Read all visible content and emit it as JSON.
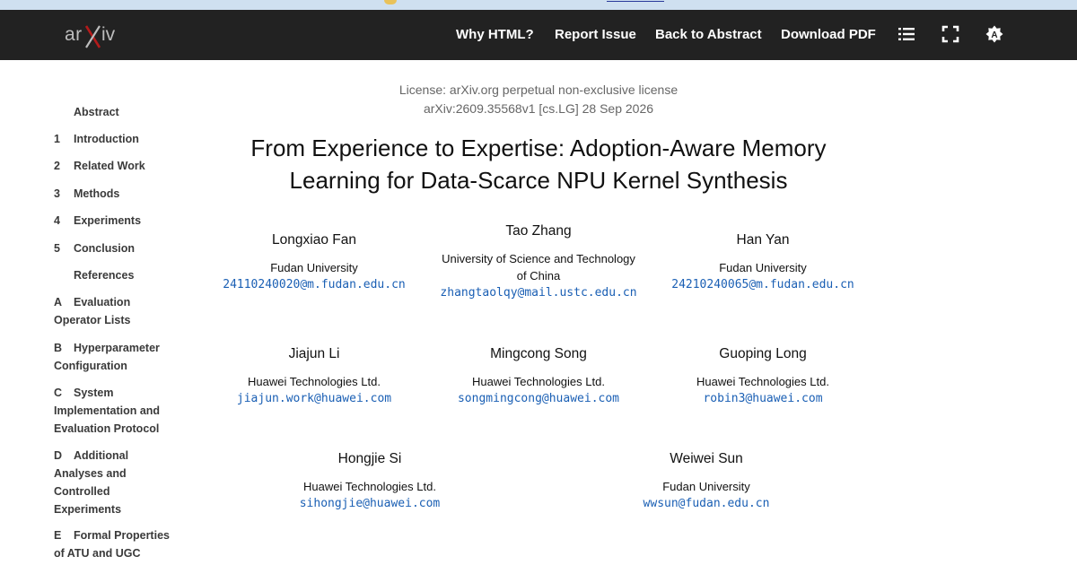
{
  "window": {
    "tab_strip_link": ""
  },
  "header": {
    "logo_text": "arXiv",
    "nav": {
      "why_html": "Why HTML?",
      "report_issue": "Report Issue",
      "back_to_abstract": "Back to Abstract",
      "download_pdf": "Download PDF"
    },
    "icons": [
      "list-icon",
      "fullscreen-icon",
      "theme-toggle-icon"
    ]
  },
  "toc": {
    "items": [
      {
        "num": "",
        "label": "Abstract"
      },
      {
        "num": "1",
        "label": "Introduction"
      },
      {
        "num": "2",
        "label": "Related Work"
      },
      {
        "num": "3",
        "label": "Methods"
      },
      {
        "num": "4",
        "label": "Experiments"
      },
      {
        "num": "5",
        "label": "Conclusion"
      },
      {
        "num": "",
        "label": "References"
      },
      {
        "num": "A",
        "label": "Evaluation",
        "label2": "Operator Lists"
      },
      {
        "num": "B",
        "label": "Hyperparameter",
        "label2": "Configuration"
      },
      {
        "num": "C",
        "label": "System",
        "label2": "Implementation and",
        "label3": "Evaluation Protocol"
      },
      {
        "num": "D",
        "label": "Additional",
        "label2": "Analyses and",
        "label3": "Controlled",
        "label4": "Experiments"
      },
      {
        "num": "E",
        "label": "Formal Properties",
        "label2": "of ATU and UGC"
      }
    ]
  },
  "paper": {
    "license": "License: arXiv.org perpetual non-exclusive license",
    "arxiv_id": "arXiv:2609.35568v1 [cs.LG] 28 Sep 2026",
    "title_line1": "From Experience to Expertise: Adoption-Aware Memory",
    "title_line2": "Learning for Data-Scarce NPU Kernel Synthesis",
    "authors": [
      {
        "name": "Longxiao Fan",
        "affiliation": "Fudan University",
        "email": "24110240020@m.fudan.edu.cn"
      },
      {
        "name": "Tao Zhang",
        "affiliation": "University of Science and Technology",
        "affiliation2": "of China",
        "email": "zhangtaolqy@mail.ustc.edu.cn"
      },
      {
        "name": "Han Yan",
        "affiliation": "Fudan University",
        "email": "24210240065@m.fudan.edu.cn"
      },
      {
        "name": "Jiajun Li",
        "affiliation": "Huawei Technologies Ltd.",
        "email": "jiajun.work@huawei.com"
      },
      {
        "name": "Mingcong Song",
        "affiliation": "Huawei Technologies Ltd.",
        "email": "songmingcong@huawei.com"
      },
      {
        "name": "Guoping Long",
        "affiliation": "Huawei Technologies Ltd.",
        "email": "robin3@huawei.com"
      },
      {
        "name": "Hongjie Si",
        "affiliation": "Huawei Technologies Ltd.",
        "email": "sihongjie@huawei.com"
      },
      {
        "name": "Weiwei Sun",
        "affiliation": "Fudan University",
        "email": "wwsun@fudan.edu.cn"
      }
    ]
  },
  "colors": {
    "navbar_bg": "#222222",
    "logo_accent": "#b31b1b",
    "email_link": "#1a5fb4",
    "toc_text": "#3a3a3a",
    "license_text": "#666666"
  }
}
